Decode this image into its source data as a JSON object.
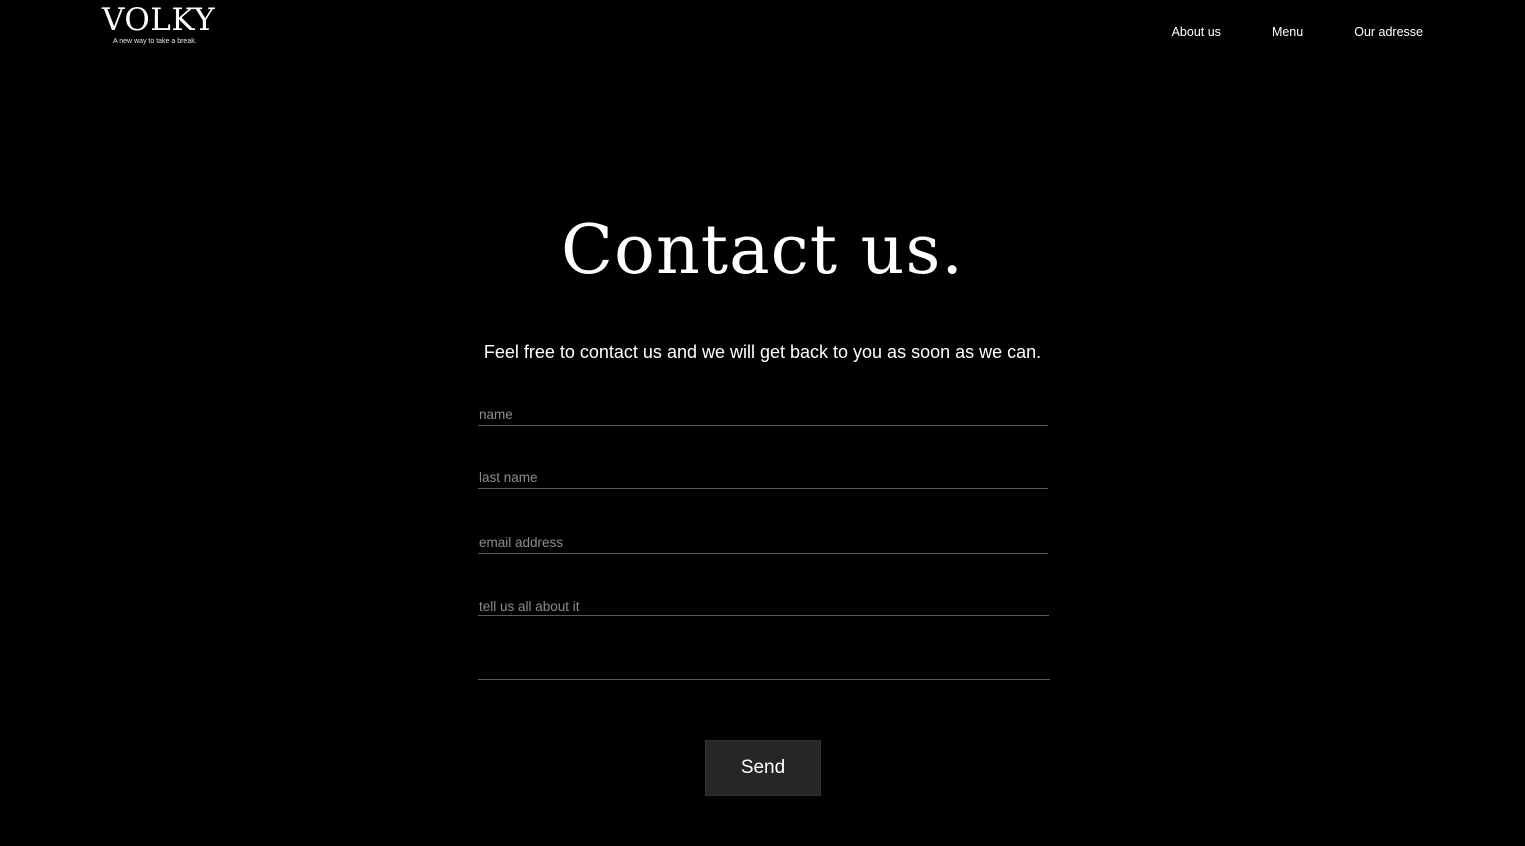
{
  "header": {
    "logo_text": "VOLKY",
    "logo_tagline": "A new way to take a break.",
    "nav": {
      "about": "About us",
      "menu": "Menu",
      "address": "Our adresse"
    }
  },
  "main": {
    "title": "Contact us.",
    "subtitle": "Feel free to contact us and we will get back to you as soon as we can.",
    "form": {
      "name_placeholder": "name",
      "last_name_placeholder": "last name",
      "email_placeholder": "email address",
      "message_placeholder": "tell us all about it",
      "submit_label": "Send"
    }
  },
  "colors": {
    "background": "#000000",
    "text": "#ffffff",
    "placeholder": "#8c8c8c",
    "underline": "#5a5a5a",
    "button": "#262626"
  }
}
